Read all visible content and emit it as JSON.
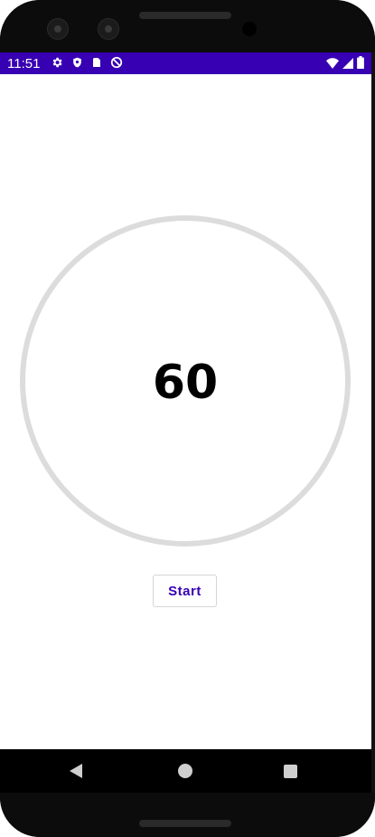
{
  "status_bar": {
    "time": "11:51",
    "background_color": "#3700b3",
    "left_icons": [
      "gear-icon",
      "shield-icon",
      "sd-card-icon",
      "no-disturb-icon"
    ],
    "right_icons": [
      "wifi-icon",
      "signal-icon",
      "battery-icon"
    ]
  },
  "timer": {
    "value": "60",
    "ring_color": "#dcdcdc"
  },
  "controls": {
    "start_label": "Start",
    "accent_color": "#3700b3"
  },
  "navigation": {
    "buttons": [
      "back-icon",
      "home-icon",
      "recents-icon"
    ]
  }
}
